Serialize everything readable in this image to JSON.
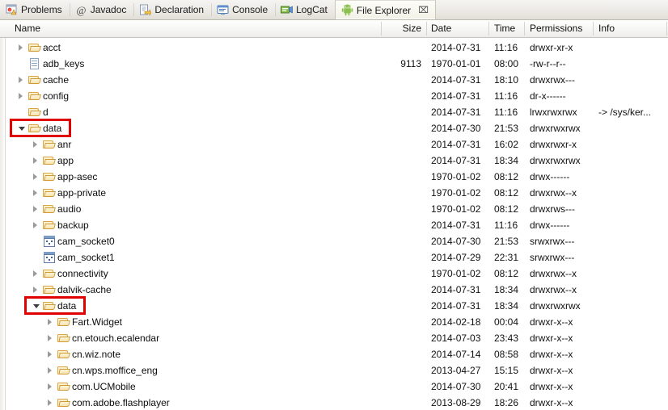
{
  "tabs": [
    {
      "label": "Problems",
      "icon": "problems-icon",
      "active": false
    },
    {
      "label": "Javadoc",
      "icon": "javadoc-at-icon",
      "active": false
    },
    {
      "label": "Declaration",
      "icon": "declaration-icon",
      "active": false
    },
    {
      "label": "Console",
      "icon": "console-icon",
      "active": false
    },
    {
      "label": "LogCat",
      "icon": "logcat-icon",
      "active": false
    },
    {
      "label": "File Explorer",
      "icon": "android-robot-icon",
      "active": true,
      "close_glyph": "⌧"
    }
  ],
  "columns": {
    "name": "Name",
    "size": "Size",
    "date": "Date",
    "time": "Time",
    "permissions": "Permissions",
    "info": "Info"
  },
  "colors": {
    "highlight": "#e00000",
    "folder_fill": "#fdf0cf",
    "folder_border": "#d9a441",
    "tab_active_bg": "#f7f6ee",
    "android_green": "#8cc152"
  },
  "rows": [
    {
      "name": "acct",
      "depth": 1,
      "icon": "folder-icon",
      "arrow": "collapsed",
      "size": "",
      "date": "2014-07-31",
      "time": "11:16",
      "permissions": "drwxr-xr-x",
      "info": ""
    },
    {
      "name": "adb_keys",
      "depth": 1,
      "icon": "file-icon",
      "arrow": "none",
      "size": "9113",
      "date": "1970-01-01",
      "time": "08:00",
      "permissions": "-rw-r--r--",
      "info": ""
    },
    {
      "name": "cache",
      "depth": 1,
      "icon": "folder-icon",
      "arrow": "collapsed",
      "size": "",
      "date": "2014-07-31",
      "time": "18:10",
      "permissions": "drwxrwx---",
      "info": ""
    },
    {
      "name": "config",
      "depth": 1,
      "icon": "folder-icon",
      "arrow": "collapsed",
      "size": "",
      "date": "2014-07-31",
      "time": "11:16",
      "permissions": "dr-x------",
      "info": ""
    },
    {
      "name": "d",
      "depth": 1,
      "icon": "folder-icon",
      "arrow": "none",
      "size": "",
      "date": "2014-07-31",
      "time": "11:16",
      "permissions": "lrwxrwxrwx",
      "info": "-> /sys/ker..."
    },
    {
      "name": "data",
      "depth": 1,
      "icon": "folder-icon",
      "arrow": "expanded",
      "size": "",
      "date": "2014-07-30",
      "time": "21:53",
      "permissions": "drwxrwxrwx",
      "info": "",
      "highlight": true
    },
    {
      "name": "anr",
      "depth": 2,
      "icon": "folder-icon",
      "arrow": "collapsed",
      "size": "",
      "date": "2014-07-31",
      "time": "16:02",
      "permissions": "drwxrwxr-x",
      "info": ""
    },
    {
      "name": "app",
      "depth": 2,
      "icon": "folder-icon",
      "arrow": "collapsed",
      "size": "",
      "date": "2014-07-31",
      "time": "18:34",
      "permissions": "drwxrwxrwx",
      "info": ""
    },
    {
      "name": "app-asec",
      "depth": 2,
      "icon": "folder-icon",
      "arrow": "collapsed",
      "size": "",
      "date": "1970-01-02",
      "time": "08:12",
      "permissions": "drwx------",
      "info": ""
    },
    {
      "name": "app-private",
      "depth": 2,
      "icon": "folder-icon",
      "arrow": "collapsed",
      "size": "",
      "date": "1970-01-02",
      "time": "08:12",
      "permissions": "drwxrwx--x",
      "info": ""
    },
    {
      "name": "audio",
      "depth": 2,
      "icon": "folder-icon",
      "arrow": "collapsed",
      "size": "",
      "date": "1970-01-02",
      "time": "08:12",
      "permissions": "drwxrws---",
      "info": ""
    },
    {
      "name": "backup",
      "depth": 2,
      "icon": "folder-icon",
      "arrow": "collapsed",
      "size": "",
      "date": "2014-07-31",
      "time": "11:16",
      "permissions": "drwx------",
      "info": ""
    },
    {
      "name": "cam_socket0",
      "depth": 2,
      "icon": "socket-icon",
      "arrow": "none",
      "size": "",
      "date": "2014-07-30",
      "time": "21:53",
      "permissions": "srwxrwx---",
      "info": ""
    },
    {
      "name": "cam_socket1",
      "depth": 2,
      "icon": "socket-icon",
      "arrow": "none",
      "size": "",
      "date": "2014-07-29",
      "time": "22:31",
      "permissions": "srwxrwx---",
      "info": ""
    },
    {
      "name": "connectivity",
      "depth": 2,
      "icon": "folder-icon",
      "arrow": "collapsed",
      "size": "",
      "date": "1970-01-02",
      "time": "08:12",
      "permissions": "drwxrwx--x",
      "info": ""
    },
    {
      "name": "dalvik-cache",
      "depth": 2,
      "icon": "folder-icon",
      "arrow": "collapsed",
      "size": "",
      "date": "2014-07-31",
      "time": "18:34",
      "permissions": "drwxrwx--x",
      "info": ""
    },
    {
      "name": "data",
      "depth": 2,
      "icon": "folder-icon",
      "arrow": "expanded",
      "size": "",
      "date": "2014-07-31",
      "time": "18:34",
      "permissions": "drwxrwxrwx",
      "info": "",
      "highlight": true
    },
    {
      "name": "Fart.Widget",
      "depth": 3,
      "icon": "folder-icon",
      "arrow": "collapsed",
      "size": "",
      "date": "2014-02-18",
      "time": "00:04",
      "permissions": "drwxr-x--x",
      "info": ""
    },
    {
      "name": "cn.etouch.ecalendar",
      "depth": 3,
      "icon": "folder-icon",
      "arrow": "collapsed",
      "size": "",
      "date": "2014-07-03",
      "time": "23:43",
      "permissions": "drwxr-x--x",
      "info": ""
    },
    {
      "name": "cn.wiz.note",
      "depth": 3,
      "icon": "folder-icon",
      "arrow": "collapsed",
      "size": "",
      "date": "2014-07-14",
      "time": "08:58",
      "permissions": "drwxr-x--x",
      "info": ""
    },
    {
      "name": "cn.wps.moffice_eng",
      "depth": 3,
      "icon": "folder-icon",
      "arrow": "collapsed",
      "size": "",
      "date": "2013-04-27",
      "time": "15:15",
      "permissions": "drwxr-x--x",
      "info": ""
    },
    {
      "name": "com.UCMobile",
      "depth": 3,
      "icon": "folder-icon",
      "arrow": "collapsed",
      "size": "",
      "date": "2014-07-30",
      "time": "20:41",
      "permissions": "drwxr-x--x",
      "info": ""
    },
    {
      "name": "com.adobe.flashplayer",
      "depth": 3,
      "icon": "folder-icon",
      "arrow": "collapsed",
      "size": "",
      "date": "2013-08-29",
      "time": "18:26",
      "permissions": "drwxr-x--x",
      "info": ""
    }
  ]
}
